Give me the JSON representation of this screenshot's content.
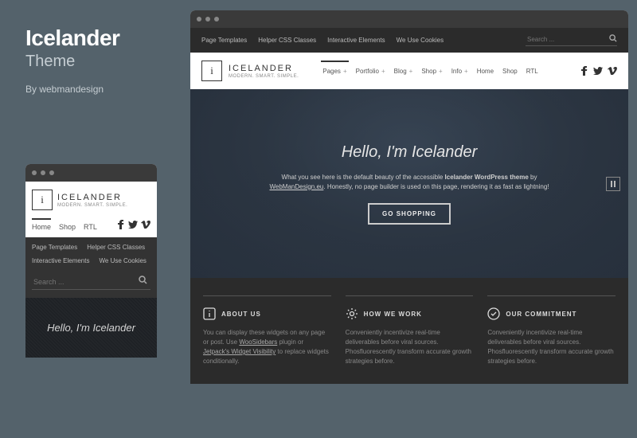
{
  "promo": {
    "title": "Icelander",
    "subtitle": "Theme",
    "byline": "By webmandesign"
  },
  "brand": {
    "logo_letter": "i",
    "name": "ICELANDER",
    "tagline": "MODERN. SMART. SIMPLE."
  },
  "topbar": {
    "items": [
      "Page Templates",
      "Helper CSS Classes",
      "Interactive Elements",
      "We Use Cookies"
    ],
    "search_placeholder": "Search ..."
  },
  "nav": {
    "items": [
      {
        "label": "Pages",
        "expand": true,
        "active": true
      },
      {
        "label": "Portfolio",
        "expand": true
      },
      {
        "label": "Blog",
        "expand": true
      },
      {
        "label": "Shop",
        "expand": true
      },
      {
        "label": "Info",
        "expand": true
      },
      {
        "label": "Home",
        "expand": false
      },
      {
        "label": "Shop",
        "expand": false
      },
      {
        "label": "RTL",
        "expand": false
      }
    ]
  },
  "mobile_nav": {
    "items": [
      {
        "label": "Home",
        "active": true
      },
      {
        "label": "Shop"
      },
      {
        "label": "RTL"
      }
    ]
  },
  "hero": {
    "title": "Hello, I'm Icelander",
    "body_pre": "What you see here is the default beauty of the accessible ",
    "body_bold": "Icelander WordPress theme",
    "body_mid": " by ",
    "body_link": "WebManDesign.eu",
    "body_post": ". Honestly, no page builder is used on this page, rendering it as fast as lightning!",
    "button": "GO SHOPPING"
  },
  "mobile_hero": {
    "title": "Hello, I'm Icelander"
  },
  "features": [
    {
      "icon": "info",
      "title": "ABOUT US",
      "body_pre": "You can display these widgets on any page or post. Use ",
      "link1": "WooSidebars",
      "body_mid": " plugin or ",
      "link2": "Jetpack's Widget Visibility",
      "body_post": " to replace widgets conditionally."
    },
    {
      "icon": "gear",
      "title": "HOW WE WORK",
      "body": "Conveniently incentivize real-time deliverables before viral sources. Phosfluorescently transform accurate growth strategies before."
    },
    {
      "icon": "check",
      "title": "OUR COMMITMENT",
      "body": "Conveniently incentivize real-time deliverables before viral sources. Phosfluorescently transform accurate growth strategies before."
    }
  ]
}
